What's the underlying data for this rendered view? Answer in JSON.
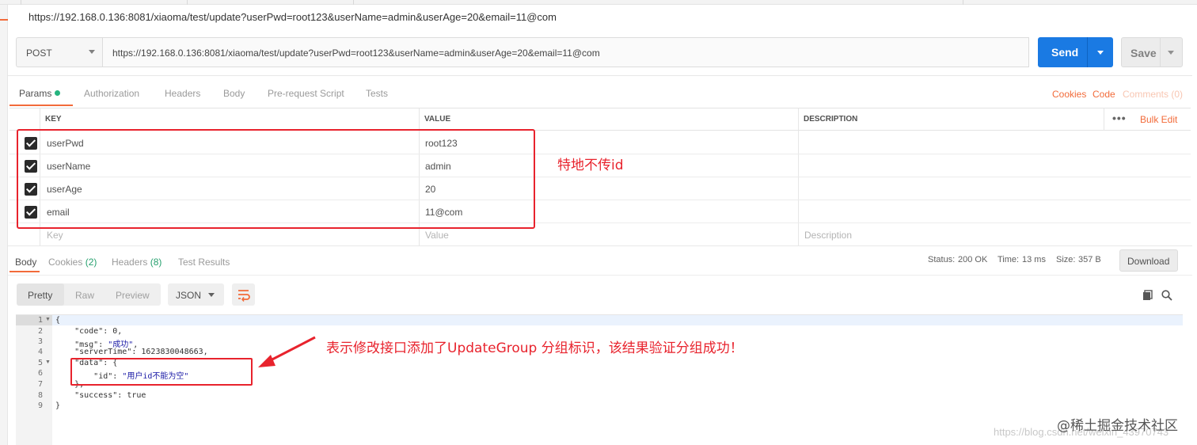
{
  "window": {
    "title_url": "https://192.168.0.136:8081/xiaoma/test/update?userPwd=root123&userName=admin&userAge=20&email=11@com"
  },
  "request": {
    "method": "POST",
    "url": "https://192.168.0.136:8081/xiaoma/test/update?userPwd=root123&userName=admin&userAge=20&email=11@com",
    "send_label": "Send",
    "save_label": "Save"
  },
  "request_tabs": [
    {
      "label": "Params"
    },
    {
      "label": "Authorization"
    },
    {
      "label": "Headers"
    },
    {
      "label": "Body"
    },
    {
      "label": "Pre-request Script"
    },
    {
      "label": "Tests"
    }
  ],
  "right_links": {
    "cookies": "Cookies",
    "code": "Code",
    "comments": "Comments (0)"
  },
  "params": {
    "headers": {
      "key": "KEY",
      "value": "VALUE",
      "description": "DESCRIPTION"
    },
    "bulk_edit": "Bulk Edit",
    "rows": [
      {
        "key": "userPwd",
        "value": "root123"
      },
      {
        "key": "userName",
        "value": "admin"
      },
      {
        "key": "userAge",
        "value": "20"
      },
      {
        "key": "email",
        "value": "11@com"
      }
    ],
    "placeholders": {
      "key": "Key",
      "value": "Value",
      "description": "Description"
    }
  },
  "annotations": {
    "params_note": "特地不传id",
    "response_note": "表示修改接口添加了UpdateGroup 分组标识，该结果验证分组成功！"
  },
  "response_tabs": {
    "body": "Body",
    "cookies": "Cookies",
    "cookies_count": "(2)",
    "headers": "Headers",
    "headers_count": "(8)",
    "test_results": "Test Results"
  },
  "response_status": {
    "status_label": "Status:",
    "status_value": "200 OK",
    "time_label": "Time:",
    "time_value": "13 ms",
    "size_label": "Size:",
    "size_value": "357 B",
    "download": "Download"
  },
  "formats": {
    "pretty": "Pretty",
    "raw": "Raw",
    "preview": "Preview",
    "json": "JSON"
  },
  "response_body": {
    "code_key": "\"code\"",
    "code_val": "0",
    "msg_key": "\"msg\"",
    "msg_val": "\"成功\"",
    "serverTime_key": "\"serverTime\"",
    "serverTime_val": "1623830048663",
    "data_key": "\"data\"",
    "id_key": "\"id\"",
    "id_val": "\"用户id不能为空\"",
    "success_key": "\"success\"",
    "success_val": "true"
  },
  "watermark": {
    "brand": "@稀土掘金技术社区",
    "url": "https://blog.csdn.net/weixin_43970743"
  },
  "colors": {
    "accent": "#f26b3a",
    "send": "#1a7ae3",
    "status_ok": "#26a06e",
    "annotation": "#e8232d"
  }
}
